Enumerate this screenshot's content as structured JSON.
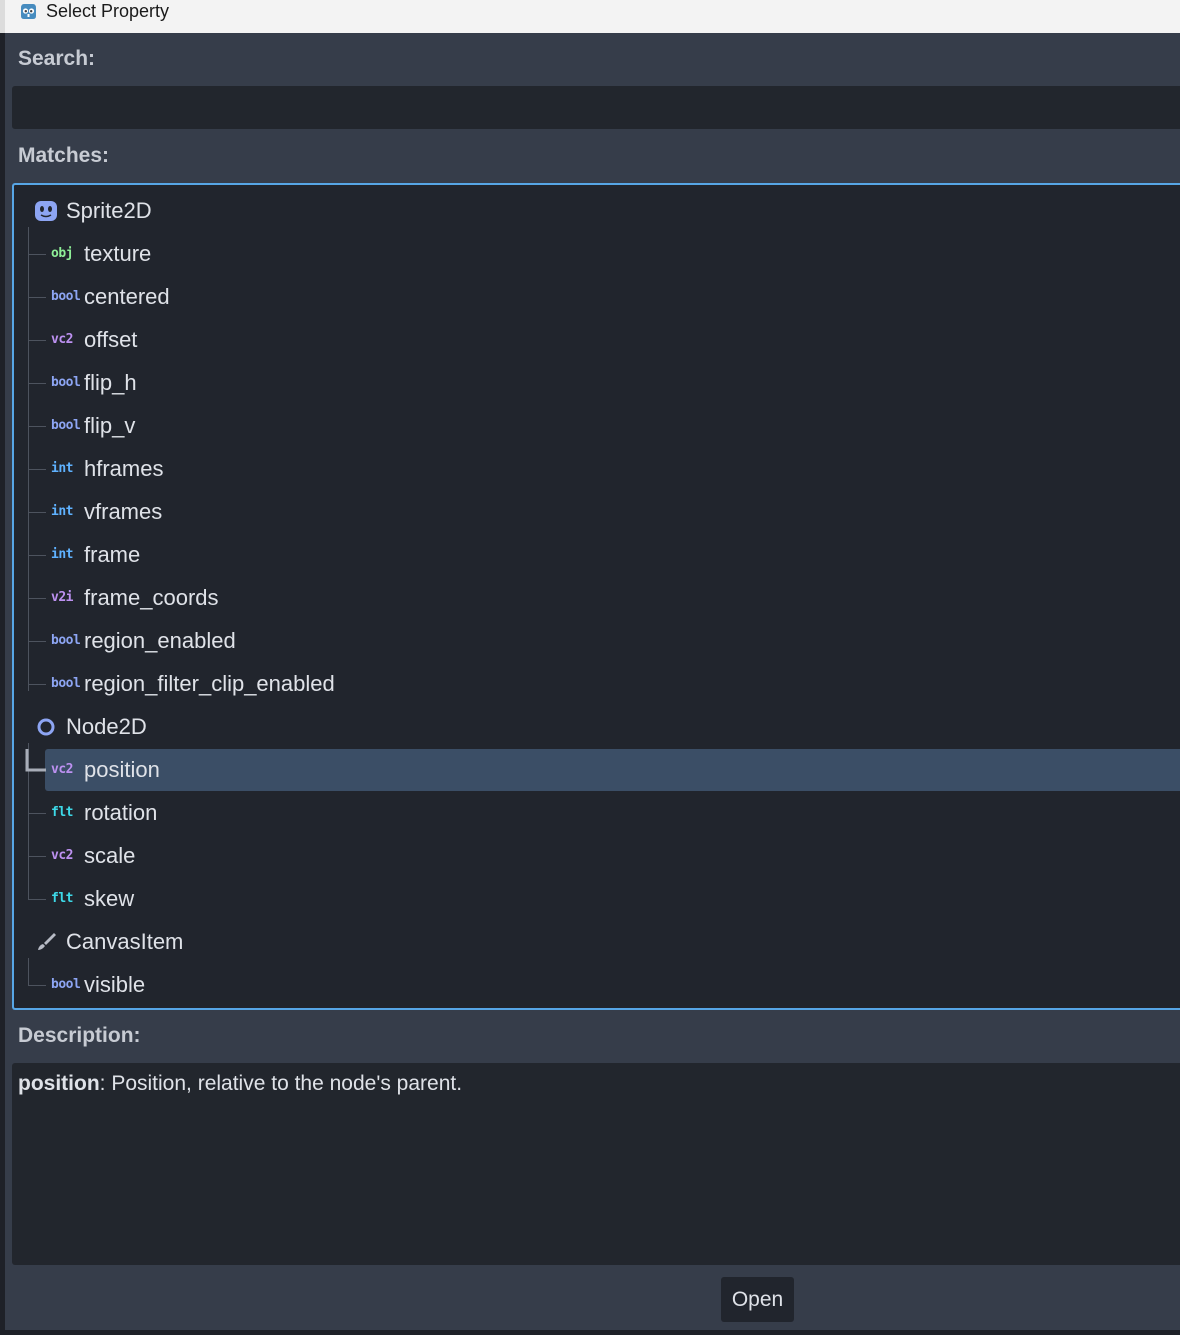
{
  "window": {
    "title": "Select Property"
  },
  "search": {
    "label": "Search:",
    "value": "",
    "placeholder": ""
  },
  "matches": {
    "label": "Matches:",
    "sprite2d": {
      "name": "Sprite2D",
      "properties": [
        {
          "type": "obj",
          "name": "texture"
        },
        {
          "type": "bool",
          "name": "centered"
        },
        {
          "type": "vc2",
          "name": "offset"
        },
        {
          "type": "bool",
          "name": "flip_h"
        },
        {
          "type": "bool",
          "name": "flip_v"
        },
        {
          "type": "int",
          "name": "hframes"
        },
        {
          "type": "int",
          "name": "vframes"
        },
        {
          "type": "int",
          "name": "frame"
        },
        {
          "type": "v2i",
          "name": "frame_coords"
        },
        {
          "type": "bool",
          "name": "region_enabled"
        },
        {
          "type": "bool",
          "name": "region_filter_clip_enabled"
        }
      ]
    },
    "node2d": {
      "name": "Node2D",
      "properties": [
        {
          "type": "vc2",
          "name": "position"
        },
        {
          "type": "flt",
          "name": "rotation"
        },
        {
          "type": "vc2",
          "name": "scale"
        },
        {
          "type": "flt",
          "name": "skew"
        }
      ]
    },
    "canvasitem": {
      "name": "CanvasItem",
      "properties": [
        {
          "type": "bool",
          "name": "visible"
        }
      ]
    },
    "selected": "position"
  },
  "description": {
    "label": "Description:",
    "property": "position",
    "text": ": Position, relative to the node's parent."
  },
  "buttons": {
    "open": "Open"
  },
  "colors": {
    "obj": "#8eef97",
    "bool": "#8da5f3",
    "vc2": "#bd91f1",
    "int": "#5fb2ff",
    "v2i": "#bd91f1",
    "flt": "#3dd9e8",
    "accent": "#57a6e6",
    "selection": "#3b4e66"
  }
}
